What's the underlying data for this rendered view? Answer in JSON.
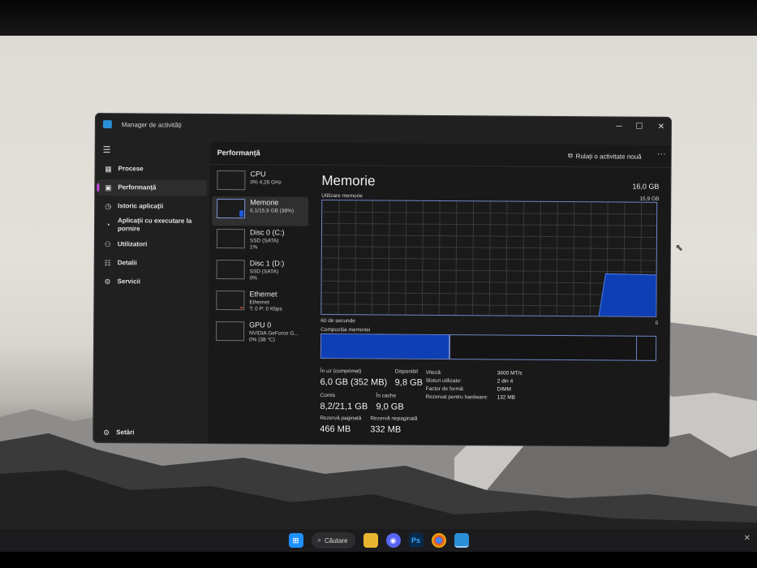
{
  "app": {
    "title": "Manager de activități"
  },
  "sidebar": {
    "items": [
      {
        "label": "Procese",
        "icon": "processes-icon"
      },
      {
        "label": "Performanță",
        "icon": "performance-icon",
        "active": true
      },
      {
        "label": "Istoric aplicații",
        "icon": "history-icon"
      },
      {
        "label": "Aplicații cu executare la pornire",
        "icon": "startup-icon"
      },
      {
        "label": "Utilizatori",
        "icon": "users-icon"
      },
      {
        "label": "Detalii",
        "icon": "details-icon"
      },
      {
        "label": "Servicii",
        "icon": "services-icon"
      }
    ],
    "settings": "Setări"
  },
  "header": {
    "title": "Performanță",
    "run_task": "Rulați o activitate nouă",
    "more": "···"
  },
  "devices": [
    {
      "name": "CPU",
      "sub1": "0% 4,26 GHz",
      "sub2": ""
    },
    {
      "name": "Memorie",
      "sub1": "6,1/15,9 GB (38%)",
      "sub2": "",
      "active": true
    },
    {
      "name": "Disc 0 (C:)",
      "sub1": "SSD (SATA)",
      "sub2": "1%"
    },
    {
      "name": "Disc 1 (D:)",
      "sub1": "SSD (SATA)",
      "sub2": "0%"
    },
    {
      "name": "Ethernet",
      "sub1": "Ethernet",
      "sub2": "T: 0 P: 0 Kbps"
    },
    {
      "name": "GPU 0",
      "sub1": "NVIDIA GeForce G...",
      "sub2": "0% (38 °C)"
    }
  ],
  "memory": {
    "title": "Memorie",
    "total": "16,0 GB",
    "usage_label": "Utilizare memorie",
    "usage_max": "15,9 GB",
    "time_label": "60 de secunde",
    "time_min": "0",
    "composition_label": "Compoziția memoriei",
    "usage_fraction": 0.38,
    "in_use_label": "În uz (comprimat)",
    "in_use_value": "6,0 GB (352 MB)",
    "available_label": "Disponibil",
    "available_value": "9,8 GB",
    "committed_label": "Comis",
    "committed_value": "8,2/21,1 GB",
    "cached_label": "În cache",
    "cached_value": "9,0 GB",
    "paged_label": "Rezervă paginată",
    "paged_value": "466 MB",
    "nonpaged_label": "Rezervă nepaginată",
    "nonpaged_value": "332 MB",
    "specs": [
      {
        "key": "Viteză:",
        "value": "3600 MT/s"
      },
      {
        "key": "Sloturi utilizate:",
        "value": "2 din 4"
      },
      {
        "key": "Factor de formă:",
        "value": "DIMM"
      },
      {
        "key": "Rezervat pentru hardware:",
        "value": "132 MB"
      }
    ]
  },
  "taskbar": {
    "search": "Căutare"
  },
  "colors": {
    "accent": "#c14bd8",
    "graph_border": "#6f86c8",
    "graph_fill": "#0f3fb5",
    "window_bg": "#202020"
  }
}
